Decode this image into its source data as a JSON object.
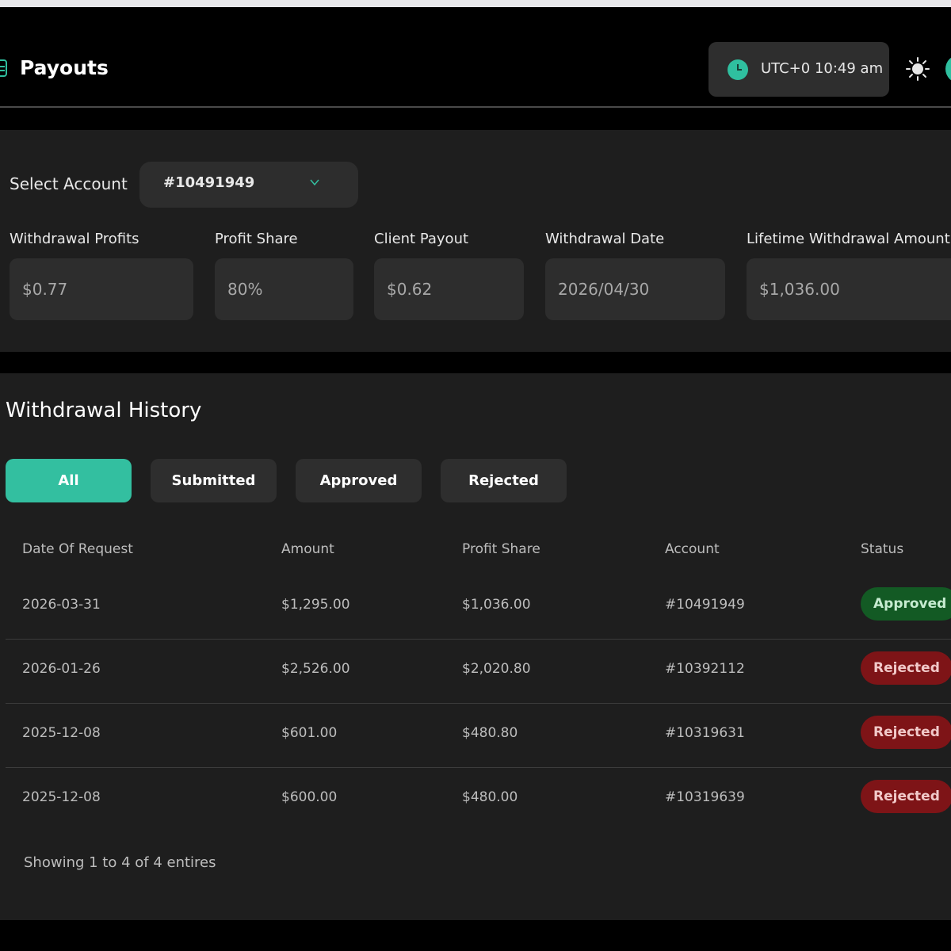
{
  "header": {
    "title": "Payouts",
    "time": "UTC+0 10:49 am",
    "icons": {
      "page": "payouts-icon",
      "clock": "clock-icon",
      "theme": "sun-icon",
      "user": "avatar"
    }
  },
  "account_panel": {
    "select_label": "Select Account",
    "selected_account": "#10491949",
    "fields": [
      {
        "label": "Withdrawal Profits",
        "value": "$0.77"
      },
      {
        "label": "Profit Share",
        "value": "80%"
      },
      {
        "label": "Client Payout",
        "value": "$0.62"
      },
      {
        "label": "Withdrawal Date",
        "value": "2026/04/30"
      },
      {
        "label": "Lifetime Withdrawal Amount A",
        "value": "$1,036.00"
      }
    ]
  },
  "history": {
    "title": "Withdrawal History",
    "tabs": [
      {
        "label": "All",
        "active": true
      },
      {
        "label": "Submitted",
        "active": false
      },
      {
        "label": "Approved",
        "active": false
      },
      {
        "label": "Rejected",
        "active": false
      }
    ],
    "columns": [
      "Date Of Request",
      "Amount",
      "Profit Share",
      "Account",
      "Status"
    ],
    "rows": [
      {
        "date": "2026-03-31",
        "amount": "$1,295.00",
        "profit_share": "$1,036.00",
        "account": "#10491949",
        "status": "Approved"
      },
      {
        "date": "2026-01-26",
        "amount": "$2,526.00",
        "profit_share": "$2,020.80",
        "account": "#10392112",
        "status": "Rejected"
      },
      {
        "date": "2025-12-08",
        "amount": "$601.00",
        "profit_share": "$480.80",
        "account": "#10319631",
        "status": "Rejected"
      },
      {
        "date": "2025-12-08",
        "amount": "$600.00",
        "profit_share": "$480.00",
        "account": "#10319639",
        "status": "Rejected"
      }
    ],
    "footer": "Showing 1 to 4 of 4 entires"
  },
  "colors": {
    "accent": "#33bfa0",
    "approved_bg": "#135a24",
    "rejected_bg": "#7e1417",
    "panel_bg": "#1e1e1e",
    "input_bg": "#2d2d2d"
  }
}
